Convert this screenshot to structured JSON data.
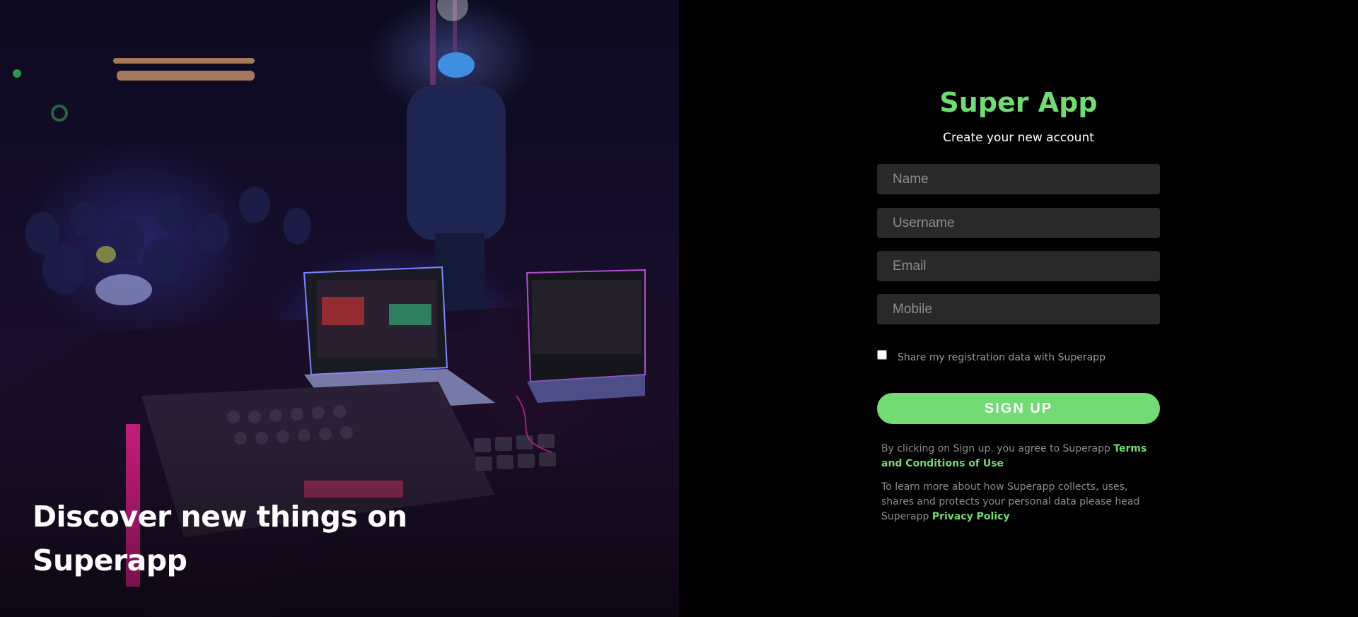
{
  "hero": {
    "headline": "Discover new things on Superapp"
  },
  "form": {
    "title": "Super App",
    "subtitle": "Create your new account",
    "fields": {
      "name_placeholder": "Name",
      "username_placeholder": "Username",
      "email_placeholder": "Email",
      "mobile_placeholder": "Mobile"
    },
    "share_checkbox": {
      "label": "Share my registration data with Superapp",
      "checked": false
    },
    "signup_button": "SIGN UP",
    "terms": {
      "prefix": "By clicking on Sign up. you agree to Superapp ",
      "link": "Terms and Conditions of Use"
    },
    "privacy": {
      "prefix": "To learn more about how Superapp collects, uses, shares and protects your personal data please head Superapp ",
      "link": "Privacy Policy"
    }
  },
  "colors": {
    "accent": "#72db73",
    "background": "#000000",
    "field_background": "#292929",
    "muted_text": "#8c8c8c"
  }
}
